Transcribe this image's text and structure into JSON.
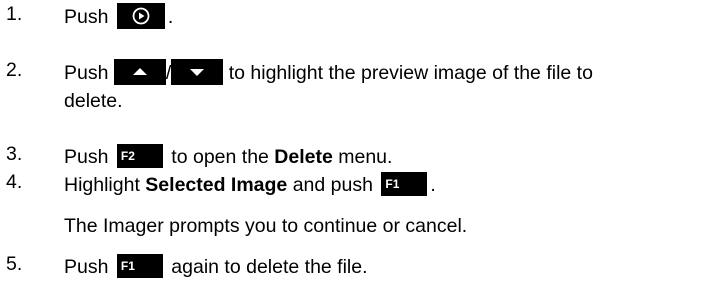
{
  "steps": [
    {
      "number": "1.",
      "push": "Push",
      "after": "."
    },
    {
      "number": "2.",
      "push": "Push",
      "sep": "/",
      "after": " to highlight the preview image of the file to",
      "line2": "delete."
    },
    {
      "number": "3.",
      "push": "Push",
      "key": "F2",
      "after_a": " to open the ",
      "bold": "Delete",
      "after_b": " menu."
    },
    {
      "number": "4.",
      "pre": "Highlight ",
      "bold": "Selected Image",
      "mid": " and push",
      "key": "F1",
      "after": "."
    },
    {
      "number": "5.",
      "push": "Push",
      "key": "F1",
      "after": " again to delete the file."
    }
  ],
  "note": "The Imager prompts you to continue or cancel.",
  "icons": [
    "play-circle-icon",
    "up-arrow-icon",
    "down-arrow-icon"
  ]
}
